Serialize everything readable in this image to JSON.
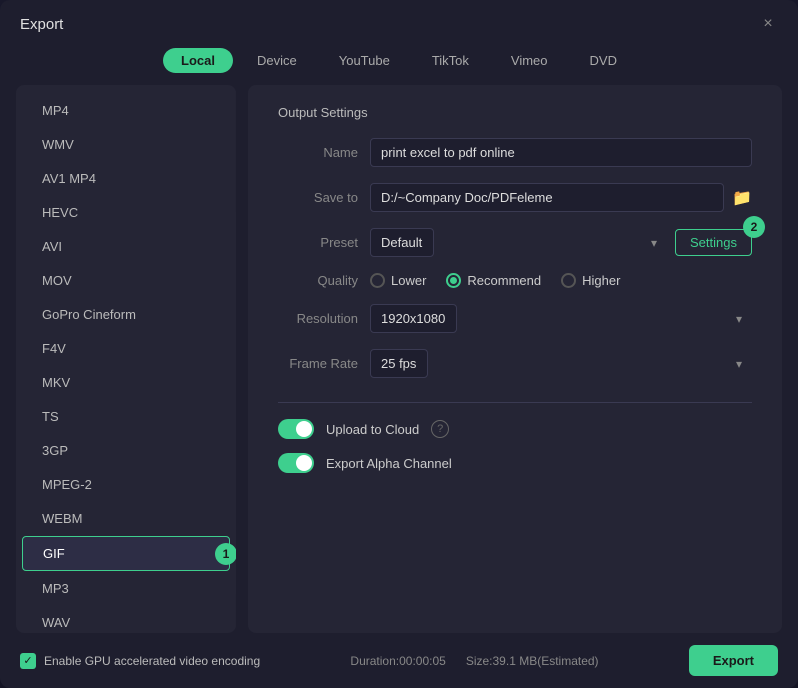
{
  "dialog": {
    "title": "Export",
    "close_label": "×"
  },
  "tabs": [
    {
      "id": "local",
      "label": "Local",
      "active": true
    },
    {
      "id": "device",
      "label": "Device",
      "active": false
    },
    {
      "id": "youtube",
      "label": "YouTube",
      "active": false
    },
    {
      "id": "tiktok",
      "label": "TikTok",
      "active": false
    },
    {
      "id": "vimeo",
      "label": "Vimeo",
      "active": false
    },
    {
      "id": "dvd",
      "label": "DVD",
      "active": false
    }
  ],
  "sidebar": {
    "items": [
      {
        "id": "mp4",
        "label": "MP4",
        "active": false
      },
      {
        "id": "wmv",
        "label": "WMV",
        "active": false
      },
      {
        "id": "av1mp4",
        "label": "AV1 MP4",
        "active": false
      },
      {
        "id": "hevc",
        "label": "HEVC",
        "active": false
      },
      {
        "id": "avi",
        "label": "AVI",
        "active": false
      },
      {
        "id": "mov",
        "label": "MOV",
        "active": false
      },
      {
        "id": "gopro",
        "label": "GoPro Cineform",
        "active": false
      },
      {
        "id": "f4v",
        "label": "F4V",
        "active": false
      },
      {
        "id": "mkv",
        "label": "MKV",
        "active": false
      },
      {
        "id": "ts",
        "label": "TS",
        "active": false
      },
      {
        "id": "3gp",
        "label": "3GP",
        "active": false
      },
      {
        "id": "mpeg2",
        "label": "MPEG-2",
        "active": false
      },
      {
        "id": "webm",
        "label": "WEBM",
        "active": false
      },
      {
        "id": "gif",
        "label": "GIF",
        "active": true
      },
      {
        "id": "mp3",
        "label": "MP3",
        "active": false
      },
      {
        "id": "wav",
        "label": "WAV",
        "active": false
      }
    ]
  },
  "output_settings": {
    "title": "Output Settings",
    "name_label": "Name",
    "name_value": "print excel to pdf online",
    "save_to_label": "Save to",
    "save_to_value": "D:/~Company Doc/PDFeleme",
    "preset_label": "Preset",
    "preset_value": "Default",
    "settings_btn_label": "Settings",
    "quality_label": "Quality",
    "quality_options": [
      {
        "id": "lower",
        "label": "Lower",
        "active": false
      },
      {
        "id": "recommend",
        "label": "Recommend",
        "active": true
      },
      {
        "id": "higher",
        "label": "Higher",
        "active": false
      }
    ],
    "resolution_label": "Resolution",
    "resolution_value": "1920x1080",
    "frame_rate_label": "Frame Rate",
    "frame_rate_value": "25 fps",
    "upload_cloud_label": "Upload to Cloud",
    "export_alpha_label": "Export Alpha Channel"
  },
  "bottom": {
    "gpu_label": "Enable GPU accelerated video encoding",
    "duration_label": "Duration:00:00:05",
    "size_label": "Size:39.1 MB(Estimated)",
    "export_label": "Export"
  },
  "badges": {
    "sidebar_badge": "1",
    "settings_badge": "2"
  }
}
